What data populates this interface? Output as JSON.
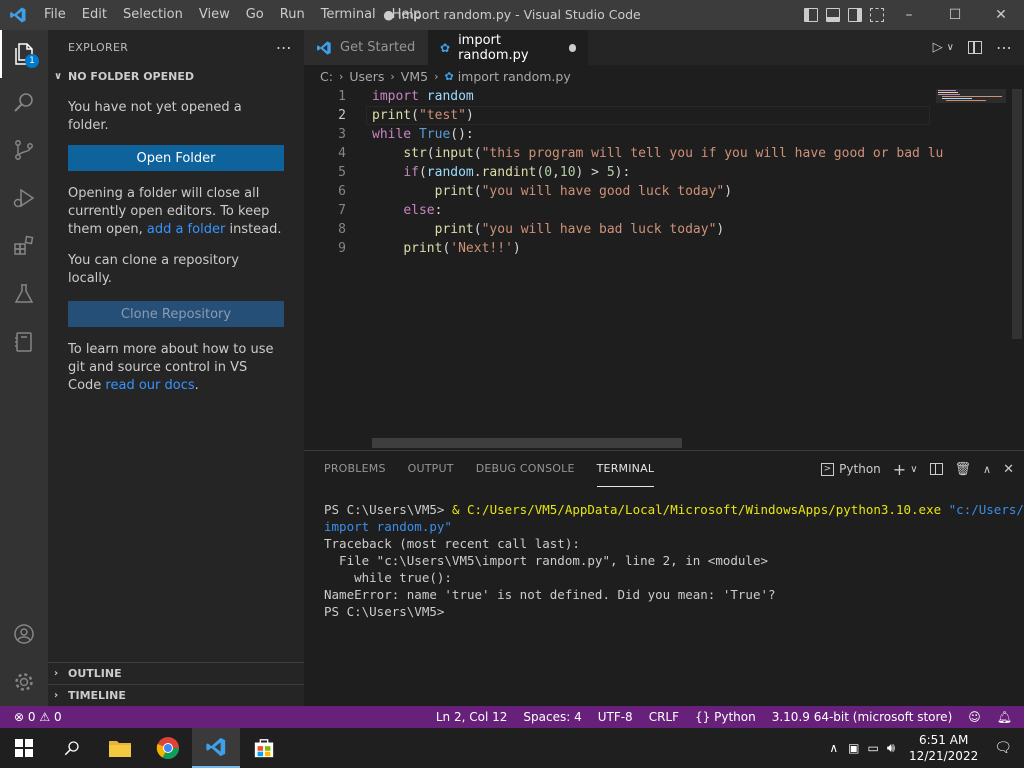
{
  "window": {
    "title": "● import random.py - Visual Studio Code",
    "menu": [
      "File",
      "Edit",
      "Selection",
      "View",
      "Go",
      "Run",
      "Terminal",
      "Help"
    ]
  },
  "sidebar": {
    "header": "EXPLORER",
    "section_title": "NO FOLDER OPENED",
    "no_folder_text": "You have not yet opened a folder.",
    "open_folder_label": "Open Folder",
    "opening_text_1": "Opening a folder will close all currently open editors. To keep them open,",
    "add_folder_link": "add a folder",
    "opening_text_2": "instead.",
    "clone_text": "You can clone a repository locally.",
    "clone_label": "Clone Repository",
    "learn_text": "To learn more about how to use git and source control in VS Code",
    "docs_link": "read our docs",
    "docs_suffix": ".",
    "outline_label": "OUTLINE",
    "timeline_label": "TIMELINE"
  },
  "tabs": [
    {
      "label": "Get Started"
    },
    {
      "label": "import random.py"
    }
  ],
  "breadcrumb": {
    "parts": [
      "C:",
      "Users",
      "VM5",
      "import random.py"
    ]
  },
  "editor": {
    "line_numbers": [
      "1",
      "2",
      "3",
      "4",
      "5",
      "6",
      "7",
      "8",
      "9"
    ],
    "lines": [
      "import random",
      "print(\"test\")",
      "while True():",
      "    str(input(\"this program will tell you if you will have good or bad lu",
      "    if(random.randint(0,10) > 5):",
      "        print(\"you will have good luck today\")",
      "    else:",
      "        print(\"you will have bad luck today\")",
      "    print('Next!!')"
    ]
  },
  "panel": {
    "tabs": [
      "PROBLEMS",
      "OUTPUT",
      "DEBUG CONSOLE",
      "TERMINAL"
    ],
    "shell_label": "Python",
    "terminal": {
      "prompt1": "PS C:\\Users\\VM5> ",
      "amp": "& ",
      "exe": "C:/Users/VM5/AppData/Local/Microsoft/WindowsApps/python3.10.exe",
      "arg1": "\"c:/Users/VM5/",
      "arg2": "import random.py\"",
      "lines": [
        "Traceback (most recent call last):",
        "  File \"c:\\Users\\VM5\\import random.py\", line 2, in <module>",
        "    while true():",
        "NameError: name 'true' is not defined. Did you mean: 'True'?",
        "PS C:\\Users\\VM5>"
      ]
    }
  },
  "statusbar": {
    "errors": "0",
    "warnings": "0",
    "position": "Ln 2, Col 12",
    "spaces": "Spaces: 4",
    "encoding": "UTF-8",
    "eol": "CRLF",
    "language": "Python",
    "interpreter": "3.10.9 64-bit (microsoft store)"
  },
  "taskbar": {
    "time": "6:51 AM",
    "date": "12/21/2022"
  },
  "activity": {
    "explorer_badge": "1"
  }
}
